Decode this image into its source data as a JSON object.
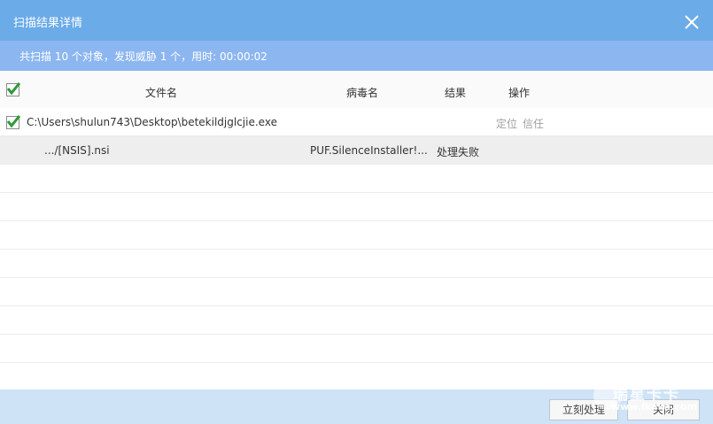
{
  "titlebar": {
    "title": "扫描结果详情"
  },
  "summary": {
    "text": "共扫描 10 个对象，发现威胁 1 个，用时: 00:00:02"
  },
  "table": {
    "headers": {
      "filename": "文件名",
      "virus": "病毒名",
      "result": "结果",
      "action": "操作"
    },
    "rows": [
      {
        "filename": "C:\\Users\\shulun743\\Desktop\\betekildjglcjie.exe",
        "virus": "",
        "result": "",
        "actions": [
          "定位",
          "信任"
        ],
        "checked": true
      },
      {
        "filename": ".../[NSIS].nsi",
        "virus": "PUF.SilenceInstaller!...",
        "result": "处理失败",
        "actions": [],
        "checked": false
      }
    ]
  },
  "footer": {
    "process_label": "立刻处理",
    "close_label": "关闭"
  },
  "watermark": {
    "brand": "瑞星卡卡",
    "url": "www.ikaka.com"
  },
  "colors": {
    "titlebar": "#6aabe8",
    "summary": "#8cb6f0",
    "footer": "#cfe3f7",
    "check": "#2e9a3a"
  }
}
